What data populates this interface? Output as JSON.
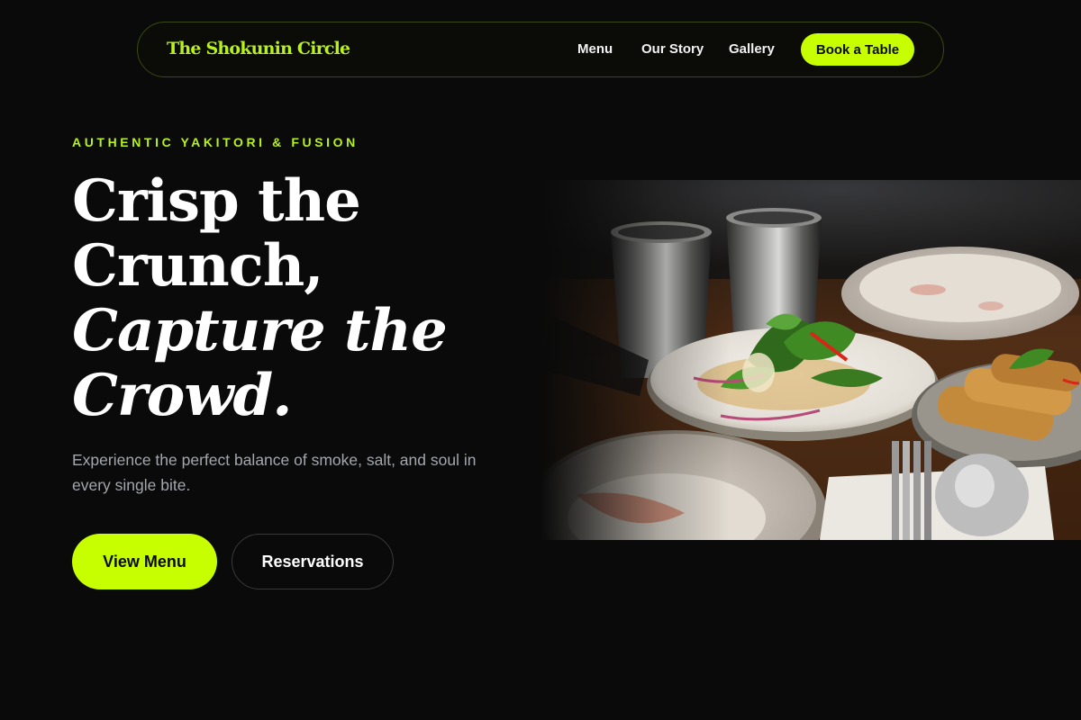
{
  "nav": {
    "brand": "The Shokunin Circle",
    "links": [
      {
        "label": "Menu"
      },
      {
        "label": "Our Story"
      },
      {
        "label": "Gallery"
      }
    ],
    "cta_label": "Book a Table"
  },
  "hero": {
    "eyebrow": "AUTHENTIC YAKITORI & FUSION",
    "headline": {
      "line1": "Crisp the",
      "line2": "Crunch,",
      "line3": "Capture the",
      "line4": "Crowd."
    },
    "subtext": "Experience the perfect balance of smoke, salt, and soul in every single bite.",
    "primary_button": "View Menu",
    "secondary_button": "Reservations",
    "image": {
      "subject": "dining table with salad plate, spring rolls, metal cups and cutlery"
    }
  },
  "colors": {
    "background": "#0a0a0a",
    "accent": "#c8ff00",
    "brand_text": "#b9f21a",
    "text_primary": "#ffffff",
    "text_muted": "#a3a7ad"
  }
}
